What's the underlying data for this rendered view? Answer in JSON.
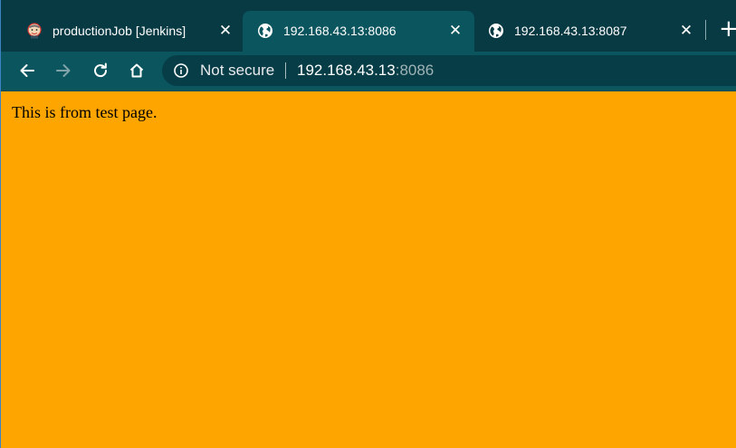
{
  "tabs": [
    {
      "title": "productionJob [Jenkins]",
      "favicon": "jenkins-butler-icon",
      "active": false
    },
    {
      "title": "192.168.43.13:8086",
      "favicon": "globe-icon",
      "active": true
    },
    {
      "title": "192.168.43.13:8087",
      "favicon": "globe-icon",
      "active": false
    }
  ],
  "toolbar": {
    "security_label": "Not secure",
    "url_host": "192.168.43.13",
    "url_port": ":8086"
  },
  "page": {
    "text": "This is from test page.",
    "background_color": "#ffa500"
  },
  "colors": {
    "tabstrip": "#083a44",
    "toolbar": "#0a555e",
    "omnibox": "#063d46"
  }
}
